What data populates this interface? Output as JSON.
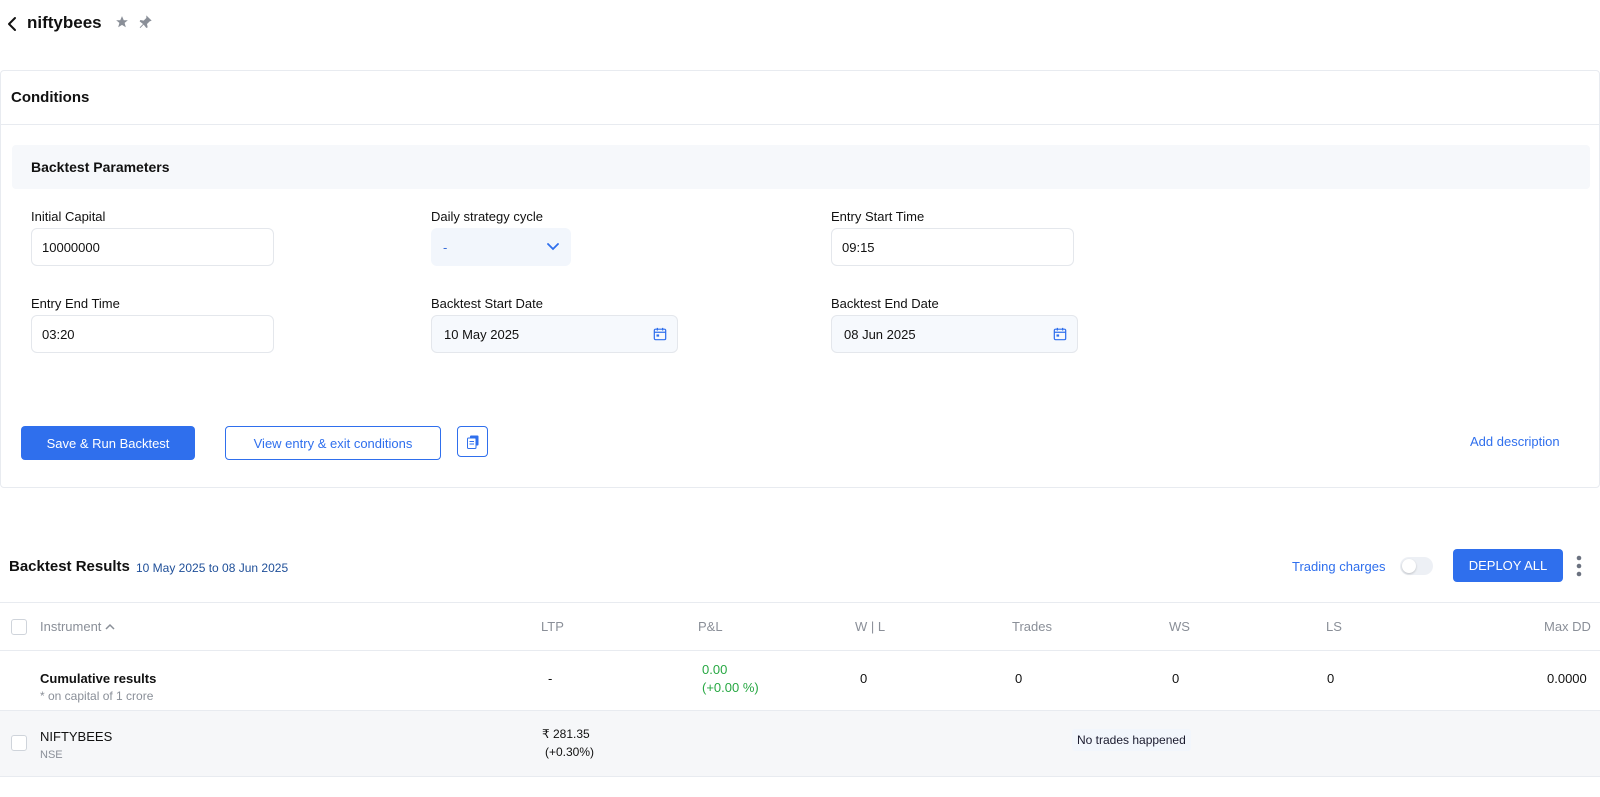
{
  "header": {
    "title": "niftybees"
  },
  "conditions": {
    "title": "Conditions",
    "params_title": "Backtest Parameters",
    "initial_capital": {
      "label": "Initial Capital",
      "value": "10000000"
    },
    "daily_cycle": {
      "label": "Daily strategy cycle",
      "value": "-"
    },
    "entry_start": {
      "label": "Entry Start Time",
      "value": "09:15"
    },
    "entry_end": {
      "label": "Entry End Time",
      "value": "03:20"
    },
    "start_date": {
      "label": "Backtest Start Date",
      "value": "10 May 2025"
    },
    "end_date": {
      "label": "Backtest End Date",
      "value": "08 Jun 2025"
    },
    "save_run_label": "Save & Run Backtest",
    "view_conditions_label": "View entry & exit conditions",
    "add_description_label": "Add description"
  },
  "results": {
    "title": "Backtest Results",
    "range": "10 May 2025 to 08 Jun 2025",
    "trading_charges_label": "Trading charges",
    "deploy_all_label": "DEPLOY ALL",
    "columns": {
      "instrument": "Instrument",
      "ltp": "LTP",
      "pnl": "P&L",
      "wl": "W | L",
      "trades": "Trades",
      "ws": "WS",
      "ls": "LS",
      "maxdd": "Max DD"
    },
    "cumulative": {
      "name": "Cumulative results",
      "note": "* on capital of 1 crore",
      "ltp": "-",
      "pnl": "0.00",
      "pnl_pct": "(+0.00 %)",
      "wl": "0",
      "trades": "0",
      "ws": "0",
      "ls": "0",
      "maxdd": "0.0000"
    },
    "rows": [
      {
        "name": "NIFTYBEES",
        "exchange": "NSE",
        "ltp": "₹ 281.35",
        "ltp_change": "(+0.30%)",
        "status": "No trades happened"
      }
    ]
  },
  "colors": {
    "primary": "#2f6fed",
    "profit": "#27a843"
  }
}
